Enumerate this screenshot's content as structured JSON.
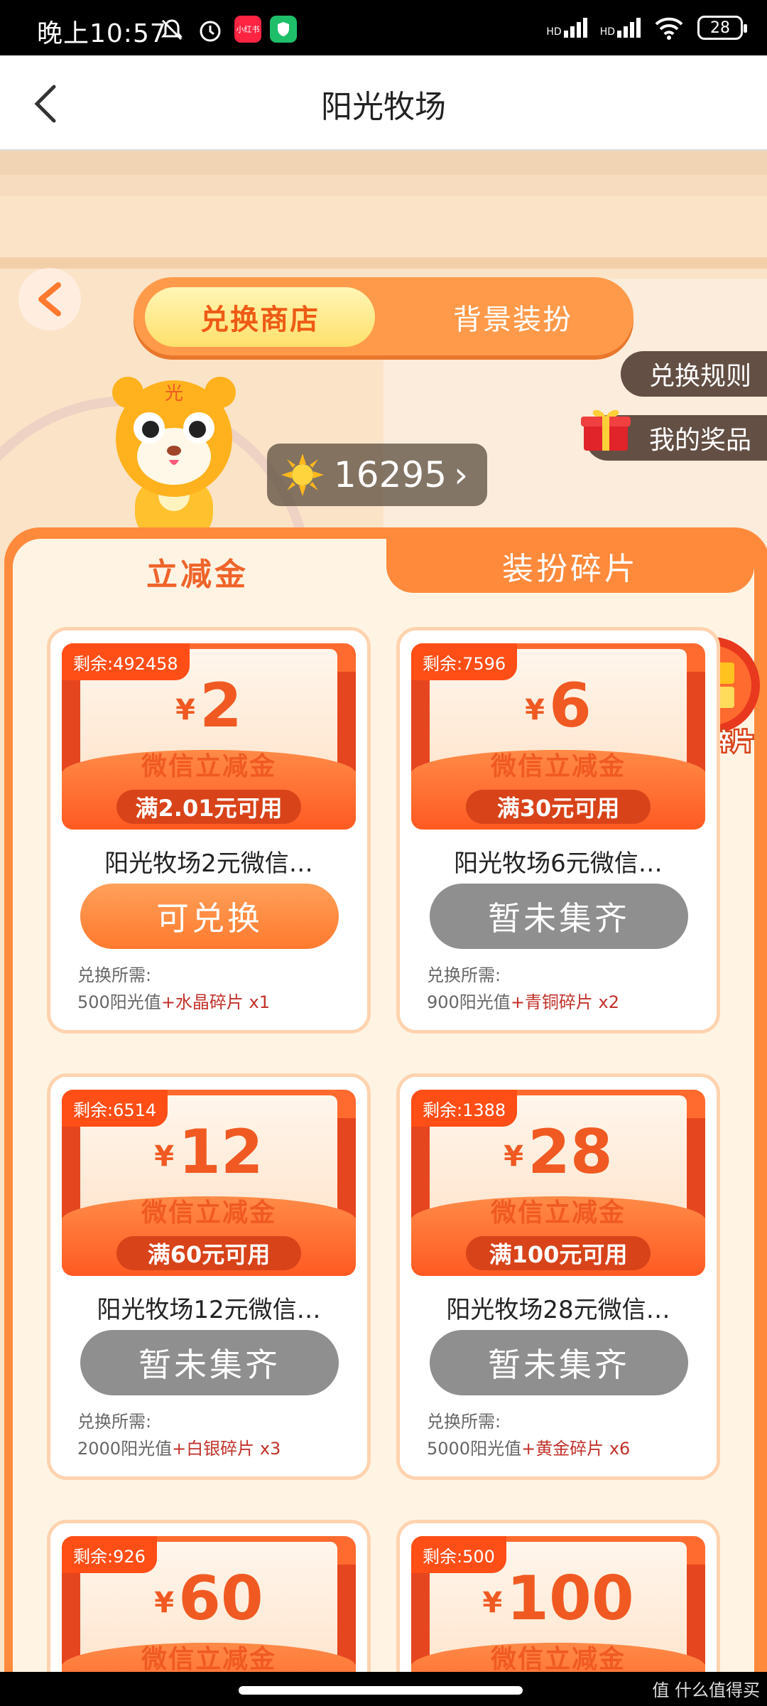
{
  "status_bar": {
    "time": "晚上10:57",
    "app_icon_text": "小红书",
    "battery": "28",
    "net1": "HD",
    "net2": "HD"
  },
  "header": {
    "title": "阳光牧场"
  },
  "shop": {
    "segment": {
      "active": "兑换商店",
      "inactive": "背景装扮"
    },
    "rules_label": "兑换规则",
    "prizes_label": "我的奖品",
    "tiger_badge": "光",
    "sunshine_value": "16295",
    "sunshine_arrow": "›",
    "tabs": {
      "active": "立减金",
      "inactive": "装扮碎片"
    },
    "my_fragments": "我的碎片"
  },
  "cards": [
    {
      "remain": "剩余:492458",
      "yen": "¥",
      "amount": "2",
      "sub": "微信立减金",
      "cond": "满2.01元可用",
      "name": "阳光牧场2元微信…",
      "button": "可兑换",
      "req_label": "兑换所需:",
      "req_value": "500阳光值",
      "req_fragment": "+水晶碎片 x1"
    },
    {
      "remain": "剩余:7596",
      "yen": "¥",
      "amount": "6",
      "sub": "微信立减金",
      "cond": "满30元可用",
      "name": "阳光牧场6元微信…",
      "button": "暂未集齐",
      "req_label": "兑换所需:",
      "req_value": "900阳光值",
      "req_fragment": "+青铜碎片 x2"
    },
    {
      "remain": "剩余:6514",
      "yen": "¥",
      "amount": "12",
      "sub": "微信立减金",
      "cond": "满60元可用",
      "name": "阳光牧场12元微信…",
      "button": "暂未集齐",
      "req_label": "兑换所需:",
      "req_value": "2000阳光值",
      "req_fragment": "+白银碎片 x3"
    },
    {
      "remain": "剩余:1388",
      "yen": "¥",
      "amount": "28",
      "sub": "微信立减金",
      "cond": "满100元可用",
      "name": "阳光牧场28元微信…",
      "button": "暂未集齐",
      "req_label": "兑换所需:",
      "req_value": "5000阳光值",
      "req_fragment": "+黄金碎片 x6"
    },
    {
      "remain": "剩余:926",
      "yen": "¥",
      "amount": "60",
      "sub": "微信立减金"
    },
    {
      "remain": "剩余:500",
      "yen": "¥",
      "amount": "100",
      "sub": "微信立减金"
    }
  ],
  "watermark": "值 什么值得买"
}
